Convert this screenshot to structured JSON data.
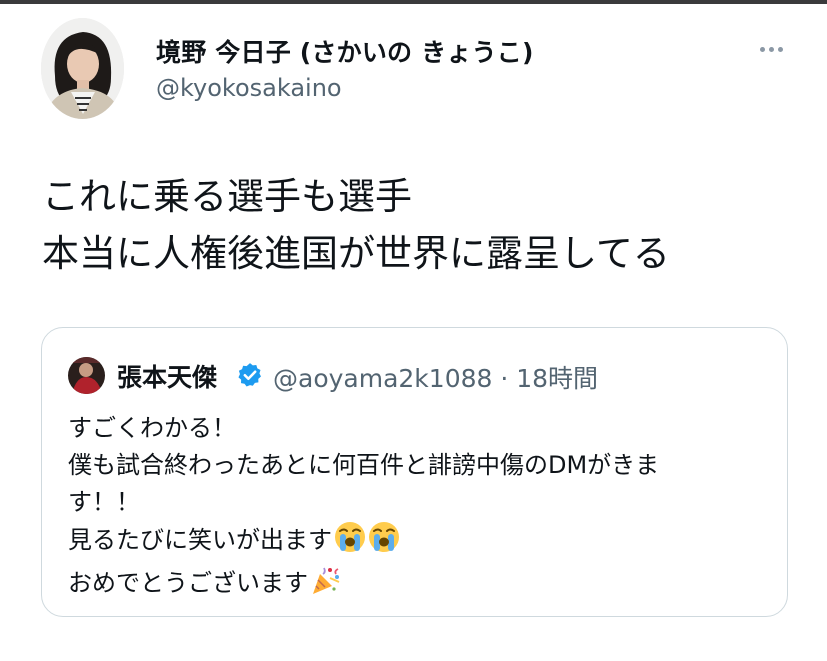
{
  "tweet": {
    "display_name": "境野 今日子 (さかいの きょうこ)",
    "handle": "@kyokosakaino",
    "text_lines": [
      "これに乗る選手も選手",
      "本当に人権後進国が世界に露呈してる"
    ],
    "more_icon": "more-horizontal-icon"
  },
  "quote": {
    "name": "張本天傑",
    "verified_icon": "verified-badge-icon",
    "meta": "@aoyama2k1088 · 18時間",
    "lines": [
      "すごくわかる！",
      "僕も試合終わったあとに何百件と誹謗中傷のDMがきま",
      "す！！",
      "見るたびに笑いが出ます",
      "おめでとうございます"
    ],
    "emojis": [
      "loudly-crying-face-emoji",
      "party-popper-emoji"
    ]
  },
  "colors": {
    "text": "#0f1419",
    "secondary": "#536471",
    "border": "#cfd9de",
    "verified": "#1d9bf0"
  }
}
